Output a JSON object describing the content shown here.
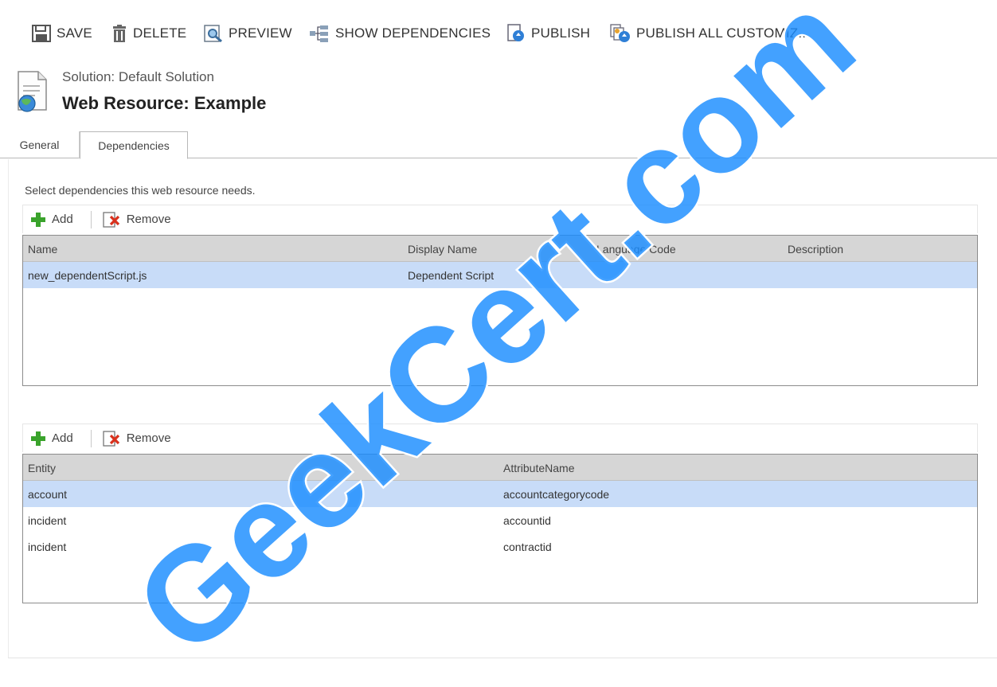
{
  "toolbar": {
    "save": "SAVE",
    "delete": "DELETE",
    "preview": "PREVIEW",
    "show_dependencies": "SHOW DEPENDENCIES",
    "publish": "PUBLISH",
    "publish_all": "PUBLISH ALL CUSTOMIZ..."
  },
  "header": {
    "solution": "Solution: Default Solution",
    "title": "Web Resource: Example"
  },
  "tabs": [
    {
      "label": "General",
      "selected": false
    },
    {
      "label": "Dependencies",
      "selected": true
    }
  ],
  "instructions": "Select dependencies this web resource needs.",
  "grid1": {
    "add": "Add",
    "remove": "Remove",
    "columns": [
      "Name",
      "Display Name",
      "Language Code",
      "Description"
    ],
    "rows": [
      {
        "name": "new_dependentScript.js",
        "display_name": "Dependent Script",
        "language_code": "",
        "description": "",
        "selected": true
      }
    ]
  },
  "grid2": {
    "add": "Add",
    "remove": "Remove",
    "columns": [
      "Entity",
      "AttributeName"
    ],
    "rows": [
      {
        "entity": "account",
        "attribute": "accountcategorycode",
        "selected": true
      },
      {
        "entity": "incident",
        "attribute": "accountid",
        "selected": false
      },
      {
        "entity": "incident",
        "attribute": "contractid",
        "selected": false
      }
    ]
  },
  "watermark": "GeekCert.com",
  "colors": {
    "selection": "#c8dcf8",
    "header_bg": "#d6d6d6",
    "watermark": "#1a8cff",
    "add_icon": "#3aa32c",
    "remove_icon": "#d9301c"
  }
}
